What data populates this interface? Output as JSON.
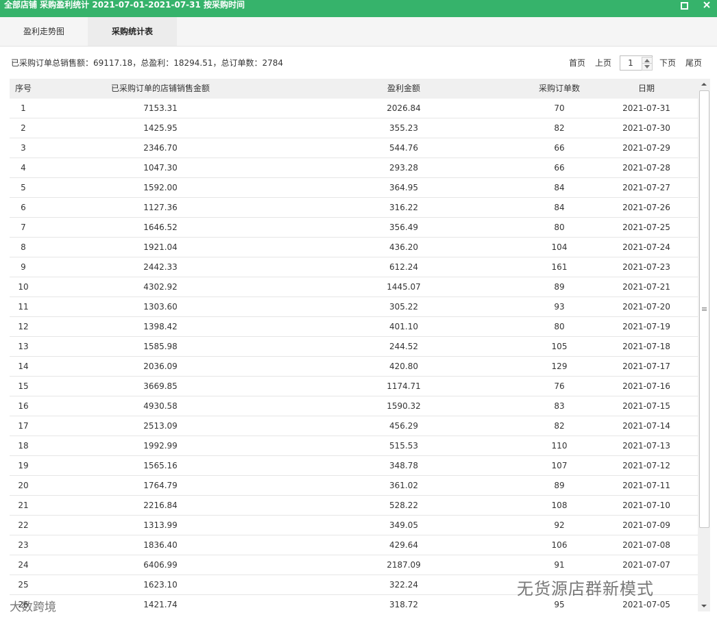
{
  "window": {
    "title": "全部店铺 采购盈利统计 2021-07-01-2021-07-31 按采购时间",
    "maximize_icon": "maximize-icon",
    "close_icon": "close-icon"
  },
  "tabs": [
    {
      "label": "盈利走势图",
      "active": false
    },
    {
      "label": "采购统计表",
      "active": true
    }
  ],
  "summary": "已采购订单总销售额：69117.18，总盈利：18294.51，总订单数：2784",
  "pager": {
    "first": "首页",
    "prev": "上页",
    "page": "1",
    "next": "下页",
    "last": "尾页"
  },
  "table": {
    "headers": [
      "序号",
      "已采购订单的店铺销售金额",
      "盈利金额",
      "采购订单数",
      "日期"
    ],
    "rows": [
      [
        "1",
        "7153.31",
        "2026.84",
        "70",
        "2021-07-31"
      ],
      [
        "2",
        "1425.95",
        "355.23",
        "82",
        "2021-07-30"
      ],
      [
        "3",
        "2346.70",
        "544.76",
        "66",
        "2021-07-29"
      ],
      [
        "4",
        "1047.30",
        "293.28",
        "66",
        "2021-07-28"
      ],
      [
        "5",
        "1592.00",
        "364.95",
        "84",
        "2021-07-27"
      ],
      [
        "6",
        "1127.36",
        "316.22",
        "84",
        "2021-07-26"
      ],
      [
        "7",
        "1646.52",
        "356.49",
        "80",
        "2021-07-25"
      ],
      [
        "8",
        "1921.04",
        "436.20",
        "104",
        "2021-07-24"
      ],
      [
        "9",
        "2442.33",
        "612.24",
        "161",
        "2021-07-23"
      ],
      [
        "10",
        "4302.92",
        "1445.07",
        "89",
        "2021-07-21"
      ],
      [
        "11",
        "1303.60",
        "305.22",
        "93",
        "2021-07-20"
      ],
      [
        "12",
        "1398.42",
        "401.10",
        "80",
        "2021-07-19"
      ],
      [
        "13",
        "1585.98",
        "244.52",
        "105",
        "2021-07-18"
      ],
      [
        "14",
        "2036.09",
        "420.80",
        "129",
        "2021-07-17"
      ],
      [
        "15",
        "3669.85",
        "1174.71",
        "76",
        "2021-07-16"
      ],
      [
        "16",
        "4930.58",
        "1590.32",
        "83",
        "2021-07-15"
      ],
      [
        "17",
        "2513.09",
        "456.29",
        "82",
        "2021-07-14"
      ],
      [
        "18",
        "1992.99",
        "515.53",
        "110",
        "2021-07-13"
      ],
      [
        "19",
        "1565.16",
        "348.78",
        "107",
        "2021-07-12"
      ],
      [
        "20",
        "1764.79",
        "361.02",
        "89",
        "2021-07-11"
      ],
      [
        "21",
        "2216.84",
        "528.22",
        "108",
        "2021-07-10"
      ],
      [
        "22",
        "1313.99",
        "349.05",
        "92",
        "2021-07-09"
      ],
      [
        "23",
        "1836.40",
        "429.64",
        "106",
        "2021-07-08"
      ],
      [
        "24",
        "6406.99",
        "2187.09",
        "91",
        "2021-07-07"
      ],
      [
        "25",
        "1623.10",
        "322.24",
        "",
        ""
      ],
      [
        "26",
        "1421.74",
        "318.72",
        "95",
        "2021-07-05"
      ]
    ]
  },
  "watermarks": {
    "right": "无货源店群新模式",
    "left": "大数跨境"
  },
  "colors": {
    "titlebar": "#36b36b",
    "active_tab": "#ececec",
    "header_row": "#f0f0f0"
  }
}
